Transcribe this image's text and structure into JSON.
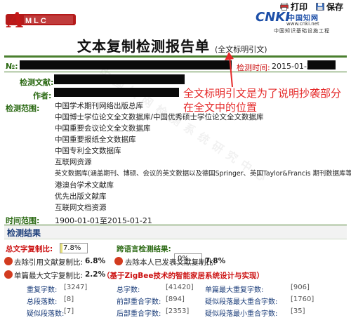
{
  "toolbar": {
    "print_label": "打印",
    "save_label": "保存"
  },
  "brand": {
    "cnki_logo": "CNKI",
    "cnki_cn": "中国知网",
    "cnki_url": "www.cnki.net",
    "cnki_sub": "中国知识基础设施工程"
  },
  "report": {
    "title": "文本复制检测报告单",
    "title_tag": "(全文标明引文)",
    "no_label": "№:",
    "detect_time_label": "检测时间:",
    "detect_time_value": "2015-01-21"
  },
  "meta": {
    "doc_label": "检测文献:",
    "author_label": "作者:",
    "range_label": "检测范围:",
    "ranges": [
      "中国学术期刊网络出版总库",
      "中国博士学位论文全文数据库/中国优秀硕士学位论文全文数据库",
      "中国重要会议论文全文数据库",
      "中国重要报纸全文数据库",
      "中国专利全文数据库",
      "互联网资源",
      "英文数据库(涵盖期刊、博硕、会议的英文数据以及德国Springer、英国Taylor&Francis 期刊数据库等)",
      "港澳台学术文献库",
      "优先出版文献库",
      "互联网文档资源"
    ],
    "time_range_label": "时间范围:",
    "time_range_value": "1900-01-01至2015-01-21"
  },
  "annotation": {
    "line1": "全文标明引文是为了说明抄袭部分",
    "line2": "在全文中的位置"
  },
  "results": {
    "section_title": "检测结果",
    "total_ratio_label": "总文字复制比:",
    "total_ratio_value": "7.8%",
    "total_ratio_fraction": 0.078,
    "cross_lang_label": "跨语言检测结果:",
    "cross_lang_value": "0%",
    "cross_lang_fraction": 0.0,
    "excl_ref_label": "去除引用文献复制比:",
    "excl_ref_value": "6.8%",
    "excl_self_label": "去除本人已发表文献复制比:",
    "excl_self_value": "7.8%",
    "max_single_label": "单篇最大文字复制比:",
    "max_single_value": "2.2%",
    "max_single_title": "（基于ZigBee技术的智能家居系统设计与实现）",
    "stats": [
      {
        "label": "重复字数:",
        "value": "[3247]"
      },
      {
        "label": "总字数:",
        "value": "[41420]"
      },
      {
        "label": "单篇最大重复字数:",
        "value": "[906]"
      },
      {
        "label": "总段落数:",
        "value": "[8]"
      },
      {
        "label": "前部重合字数:",
        "value": "[894]"
      },
      {
        "label": "疑似段落最大重合字数:",
        "value": "[1760]"
      },
      {
        "label": "疑似段落数:",
        "value": "[7]"
      },
      {
        "label": "后部重合字数:",
        "value": "[2353]"
      },
      {
        "label": "疑似段落最小重合字数:",
        "value": "[35]"
      }
    ]
  },
  "watermark": "中国知网检测系统研究中心",
  "colors": {
    "accent_green": "#4a7f2e",
    "label_green": "#2c6a14",
    "annotation_red": "#e52a2a",
    "heading_blue": "#1b3d7a"
  }
}
